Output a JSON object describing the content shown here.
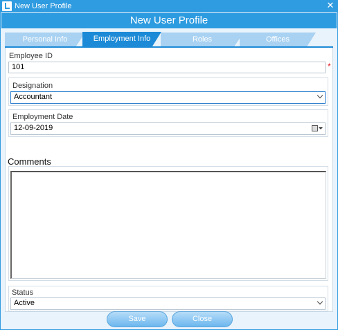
{
  "window": {
    "title": "New User Profile"
  },
  "header": {
    "title": "New User Profile"
  },
  "tabs": [
    {
      "label": "Personal Info",
      "active": false
    },
    {
      "label": "Employment Info",
      "active": true
    },
    {
      "label": "Roles",
      "active": false
    },
    {
      "label": "Offices",
      "active": false
    }
  ],
  "form": {
    "employee_id": {
      "label": "Employee ID",
      "value": "101",
      "required_mark": "*"
    },
    "designation": {
      "label": "Designation",
      "value": "Accountant"
    },
    "employment_date": {
      "label": "Employment Date",
      "value": "12-09-2019"
    },
    "comments": {
      "label": "Comments",
      "value": ""
    },
    "status": {
      "label": "Status",
      "value": "Active"
    }
  },
  "buttons": {
    "save": "Save",
    "close": "Close"
  },
  "colors": {
    "accent": "#2d9be0",
    "active_tab": "#1c8ad6",
    "inactive_tab": "#a9d2f2",
    "required": "#e02020"
  }
}
